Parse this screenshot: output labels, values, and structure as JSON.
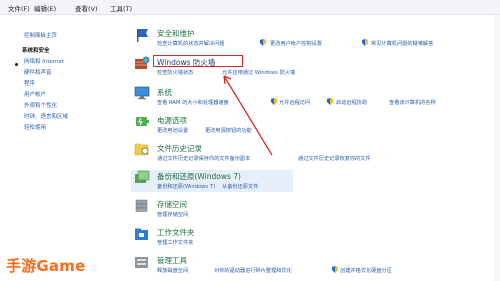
{
  "menubar": {
    "items": [
      "文件(F)",
      "编辑(E)",
      "查看(V)",
      "工具(T)"
    ]
  },
  "sidebar": {
    "home": "控制面板主页",
    "items": [
      "系统和安全",
      "网络和 Internet",
      "硬件和声音",
      "程序",
      "用户帐户",
      "外观和个性化",
      "时钟、语言和区域",
      "轻松使用"
    ]
  },
  "categories": {
    "security": {
      "title": "安全和维护",
      "links": [
        "检查计算机的状态并解决问题",
        "更改用户帐户控制设置",
        "常见计算机问题的疑难解答"
      ]
    },
    "firewall": {
      "title": "Windows 防火墙",
      "links": [
        "检查防火墙状态",
        "允许应用通过 Windows 防火墙"
      ]
    },
    "system": {
      "title": "系统",
      "links": [
        "查看 RAM 的大小和处理器速度",
        "允许远程访问",
        "启动远程协助",
        "查看该计算机的名称"
      ]
    },
    "power": {
      "title": "电源选项",
      "links": [
        "更改电池设置",
        "更改电源按钮的功能"
      ]
    },
    "filehistory": {
      "title": "文件历史记录",
      "links": [
        "通过文件历史记录保存你的文件备份副本",
        "通过文件历史记录恢复你的文件"
      ]
    },
    "backup": {
      "title": "备份和还原(Windows 7)",
      "links": [
        "备份和还原(Windows 7)",
        "从备份还原文件"
      ]
    },
    "storage": {
      "title": "存储空间",
      "links": [
        "管理存储空间"
      ]
    },
    "workfolders": {
      "title": "工作文件夹",
      "links": [
        "管理工作文件夹"
      ]
    },
    "admin": {
      "title": "管理工具",
      "links": [
        "释放磁盘空间",
        "对你的驱动器进行碎片整理和优化",
        "创建并格式化硬盘分区"
      ]
    }
  },
  "watermark": "手游Game",
  "colors": {
    "annotation": "#d62b2b",
    "link": "#2b5ea8",
    "title": "#1f6e3d",
    "watermark": "#ff6a1a"
  }
}
